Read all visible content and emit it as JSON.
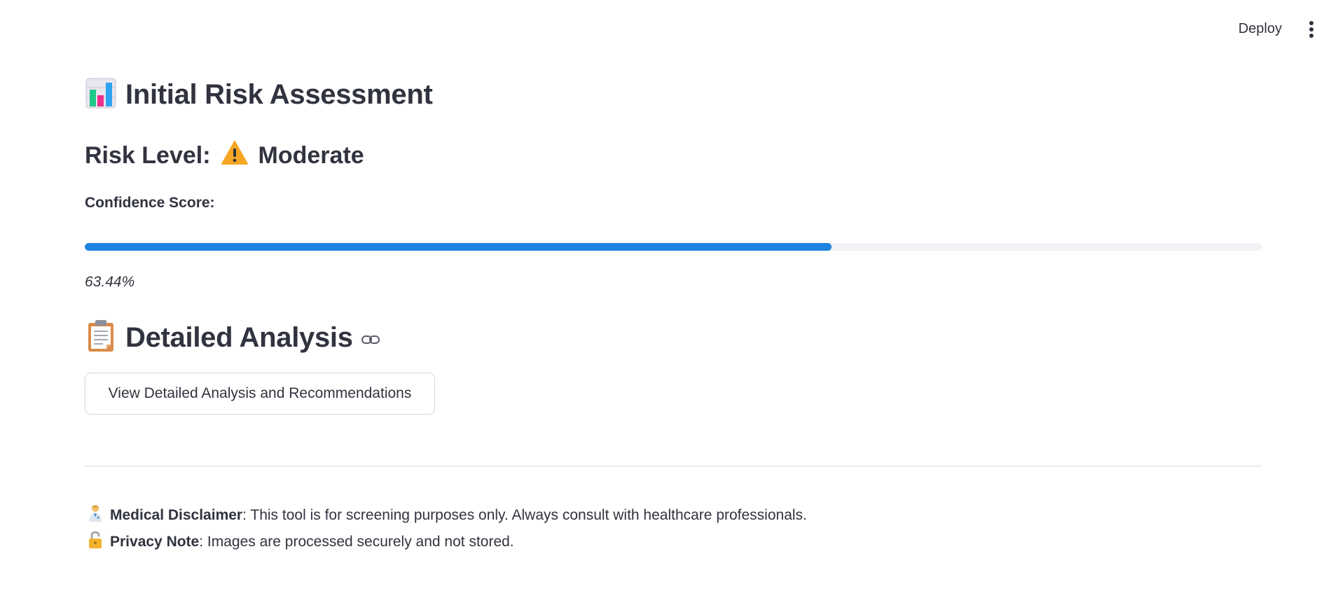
{
  "toolbar": {
    "deploy_label": "Deploy",
    "menu_icon": "more-vertical-icon"
  },
  "header": {
    "icon": "bar-chart-icon",
    "title": "Initial Risk Assessment"
  },
  "risk": {
    "label": "Risk Level:",
    "icon": "warning-icon",
    "value": "Moderate"
  },
  "confidence": {
    "label": "Confidence Score:",
    "progress_fraction": 0.6344,
    "percent_text": "63.44%",
    "fill_color": "#1c83e1"
  },
  "analysis": {
    "icon": "clipboard-icon",
    "title": "Detailed Analysis",
    "link_icon": "link-icon",
    "button_label": "View Detailed Analysis and Recommendations"
  },
  "footer": {
    "disclaimer_icon": "doctor-icon",
    "disclaimer_title": "Medical Disclaimer",
    "disclaimer_text": ": This tool is for screening purposes only. Always consult with healthcare professionals.",
    "privacy_icon": "lock-icon",
    "privacy_title": "Privacy Note",
    "privacy_text": ": Images are processed securely and not stored."
  }
}
